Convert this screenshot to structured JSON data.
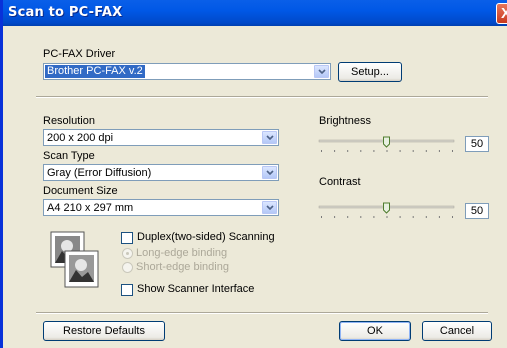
{
  "window": {
    "title": "Scan to PC-FAX",
    "close_glyph": "X"
  },
  "fax_driver": {
    "label": "PC-FAX Driver",
    "value": "Brother PC-FAX v.2",
    "setup_label": "Setup..."
  },
  "resolution": {
    "label": "Resolution",
    "value": "200 x 200 dpi"
  },
  "scan_type": {
    "label": "Scan Type",
    "value": "Gray (Error Diffusion)"
  },
  "document_size": {
    "label": "Document Size",
    "value": "A4 210 x 297 mm"
  },
  "duplex": {
    "label": "Duplex(two-sided) Scanning",
    "checked": false,
    "long_edge": "Long-edge binding",
    "short_edge": "Short-edge binding",
    "selected": "long_edge"
  },
  "show_scanner": {
    "label": "Show Scanner Interface",
    "checked": false
  },
  "brightness": {
    "label": "Brightness",
    "value": "50",
    "level": 0.5
  },
  "contrast": {
    "label": "Contrast",
    "value": "50",
    "level": 0.5
  },
  "buttons": {
    "restore": "Restore Defaults",
    "ok": "OK",
    "cancel": "Cancel"
  },
  "icons": {
    "dropdown": "chevron-down-icon",
    "duplex_preview": "duplex-pages-icon"
  }
}
